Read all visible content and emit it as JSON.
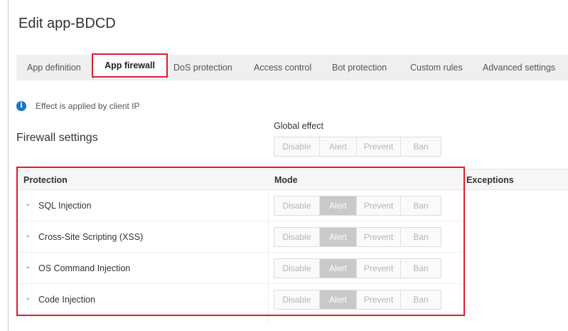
{
  "title": "Edit app-BDCD",
  "tabs": [
    {
      "label": "App definition",
      "active": false
    },
    {
      "label": "App firewall",
      "active": true
    },
    {
      "label": "DoS protection",
      "active": false
    },
    {
      "label": "Access control",
      "active": false
    },
    {
      "label": "Bot protection",
      "active": false
    },
    {
      "label": "Custom rules",
      "active": false
    },
    {
      "label": "Advanced settings",
      "active": false
    }
  ],
  "info": {
    "icon": "info-icon",
    "text": "Effect is applied by client IP"
  },
  "firewall": {
    "section_title": "Firewall settings",
    "global_effect_label": "Global effect",
    "effect_options": [
      "Disable",
      "Alert",
      "Prevent",
      "Ban"
    ],
    "global_selected": null
  },
  "table": {
    "headers": {
      "protection": "Protection",
      "mode": "Mode",
      "exceptions": "Exceptions"
    },
    "rows": [
      {
        "protection": "SQL Injection",
        "mode": "Alert"
      },
      {
        "protection": "Cross-Site Scripting (XSS)",
        "mode": "Alert"
      },
      {
        "protection": "OS Command Injection",
        "mode": "Alert"
      },
      {
        "protection": "Code Injection",
        "mode": "Alert"
      }
    ]
  },
  "colors": {
    "highlight": "#de1b2c",
    "info": "#1a73c8",
    "selected_segment": "#c9c9c9"
  }
}
